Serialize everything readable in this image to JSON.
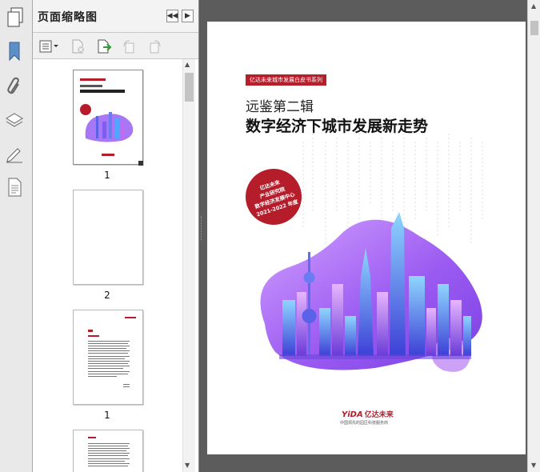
{
  "thumbnails_panel": {
    "title": "页面缩略图",
    "pages": [
      {
        "label": "1"
      },
      {
        "label": "2"
      },
      {
        "label": "1"
      }
    ]
  },
  "icons": {
    "panel": "pages-panel-icon",
    "bookmark": "bookmark-icon",
    "attachment": "paperclip-icon",
    "layers": "layers-icon",
    "signatures": "signature-icon",
    "content": "document-icon",
    "thumb_options": "thumbnail-options-icon",
    "delete": "delete-page-icon",
    "insert": "insert-page-icon",
    "rotate_ccw": "rotate-ccw-icon",
    "rotate_cw": "rotate-cw-icon",
    "collapse": "collapse-panel-icon",
    "expand": "expand-panel-icon"
  },
  "cover": {
    "series_tag": "亿达未来城市发展白皮书系列",
    "subtitle": "远鉴第二辑",
    "title": "数字经济下城市发展新走势",
    "stamp": [
      "亿达未来",
      "产业研究院",
      "数字经济发展中心",
      "2021-2022 年度"
    ],
    "brand_en": "YiDA",
    "brand_cn": "亿达未来",
    "brand_slogan": "中国领先的园区科技服务商"
  },
  "colors": {
    "accent_red": "#b51d2b",
    "skyline_purple": "#8a5cf0",
    "skyline_blue": "#46a6ff"
  }
}
